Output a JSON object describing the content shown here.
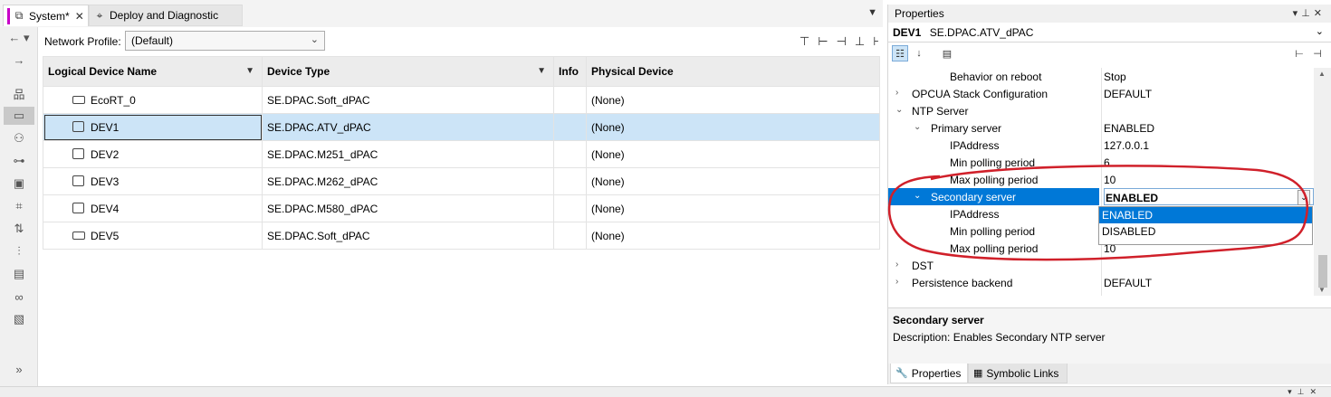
{
  "tabs": [
    {
      "label": "System*",
      "icon": "network-tree-icon",
      "active": true
    },
    {
      "label": "Deploy and Diagnostic",
      "icon": "deploy-icon",
      "active": false
    }
  ],
  "toolbar": {
    "network_profile_label": "Network Profile:",
    "network_profile_value": "(Default)"
  },
  "grid": {
    "columns": [
      "Logical Device Name",
      "Device Type",
      "Info",
      "Physical Device"
    ],
    "rows": [
      {
        "name": "EcoRT_0",
        "type": "SE.DPAC.Soft_dPAC",
        "info": "",
        "physical": "(None)",
        "icon": "soft-device-icon"
      },
      {
        "name": "DEV1",
        "type": "SE.DPAC.ATV_dPAC",
        "info": "",
        "physical": "(None)",
        "icon": "drive-device-icon",
        "selected": true
      },
      {
        "name": "DEV2",
        "type": "SE.DPAC.M251_dPAC",
        "info": "",
        "physical": "(None)",
        "icon": "controller-device-icon"
      },
      {
        "name": "DEV3",
        "type": "SE.DPAC.M262_dPAC",
        "info": "",
        "physical": "(None)",
        "icon": "controller-device-icon"
      },
      {
        "name": "DEV4",
        "type": "SE.DPAC.M580_dPAC",
        "info": "",
        "physical": "(None)",
        "icon": "controller-device-icon"
      },
      {
        "name": "DEV5",
        "type": "SE.DPAC.Soft_dPAC",
        "info": "",
        "physical": "(None)",
        "icon": "soft-device-icon"
      }
    ]
  },
  "properties": {
    "title": "Properties",
    "object_name": "DEV1",
    "object_type": "SE.DPAC.ATV_dPAC",
    "rows": [
      {
        "name": "Behavior on reboot",
        "value": "Stop"
      },
      {
        "name": "OPCUA Stack Configuration",
        "value": "DEFAULT"
      },
      {
        "name": "NTP Server",
        "value": ""
      },
      {
        "name": "Primary server",
        "value": "ENABLED"
      },
      {
        "name": "IPAddress",
        "value": "127.0.0.1"
      },
      {
        "name": "Min polling period",
        "value": "6"
      },
      {
        "name": "Max polling period",
        "value": "10"
      },
      {
        "name": "Secondary server",
        "value": "ENABLED"
      },
      {
        "name": "IPAddress",
        "value": ""
      },
      {
        "name": "Min polling period",
        "value": ""
      },
      {
        "name": "Max polling period",
        "value": "10"
      },
      {
        "name": "DST",
        "value": ""
      },
      {
        "name": "Persistence backend",
        "value": "DEFAULT"
      }
    ],
    "dropdown_options": [
      "ENABLED",
      "DISABLED"
    ],
    "description_title": "Secondary server",
    "description_text": "Description: Enables Secondary NTP server",
    "bottom_tabs": [
      "Properties",
      "Symbolic Links"
    ]
  },
  "colors": {
    "accent": "#c800c8",
    "selection": "#0078d7",
    "row_highlight": "#cce4f7",
    "annotation": "#d0202a"
  }
}
